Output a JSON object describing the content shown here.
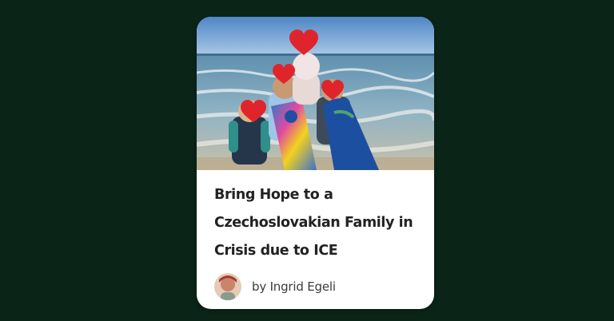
{
  "card": {
    "title": "Bring Hope to a Czechoslovakian Family in Crisis due to ICE",
    "author_prefix": "by",
    "author_name": "Ingrid Egeli",
    "author_line": "by Ingrid Egeli"
  },
  "photo": {
    "overlay_icon": "red-heart-icon",
    "overlay_count": 4
  },
  "colors": {
    "page_background": "#0b2418",
    "card_background": "#ffffff",
    "title_text": "#222222",
    "author_text": "#3a3a3a",
    "heart": "#e0242b"
  }
}
